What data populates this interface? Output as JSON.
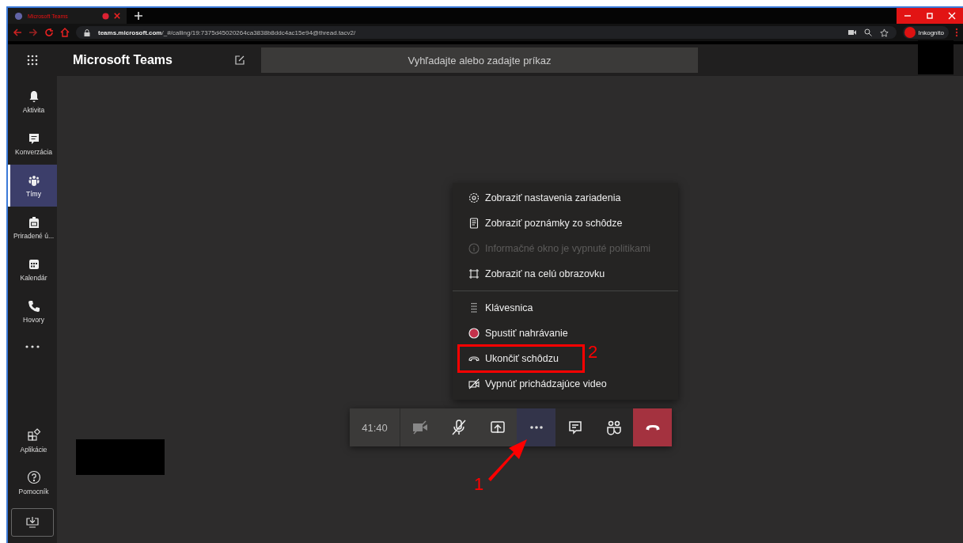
{
  "browser": {
    "tab_title": "Microsoft Teams",
    "url_host": "teams.microsoft.com",
    "url_path": "/_#/calling/19:7375d45020264ca3838b8ddc4ac15e94@thread.tacv2/",
    "profile": "Inkognito"
  },
  "app": {
    "title": "Microsoft Teams",
    "search": {
      "placeholder": "Vyhľadajte alebo zadajte príkaz"
    }
  },
  "sidebar": {
    "items": [
      {
        "label": "Aktivita",
        "selected": false
      },
      {
        "label": "Konverzácia",
        "selected": false
      },
      {
        "label": "Tímy",
        "selected": true
      },
      {
        "label": "Priradené ú...",
        "selected": false
      },
      {
        "label": "Kalendár",
        "selected": false
      },
      {
        "label": "Hovory",
        "selected": false
      }
    ],
    "bottom_items": [
      {
        "label": "Aplikácie"
      },
      {
        "label": "Pomocník"
      }
    ]
  },
  "menu": {
    "sections": [
      [
        {
          "label": "Zobraziť nastavenia zariadenia",
          "disabled": false,
          "highlighted": false
        },
        {
          "label": "Zobraziť poznámky zo schôdze",
          "disabled": false,
          "highlighted": false
        },
        {
          "label": "Informačné okno je vypnuté politikami",
          "disabled": true,
          "highlighted": false
        },
        {
          "label": "Zobraziť na celú obrazovku",
          "disabled": false,
          "highlighted": false
        }
      ],
      [
        {
          "label": "Klávesnica",
          "disabled": false,
          "highlighted": false
        },
        {
          "label": "Spustiť nahrávanie",
          "disabled": false,
          "highlighted": false
        },
        {
          "label": "Ukončiť schôdzu",
          "disabled": false,
          "highlighted": true
        },
        {
          "label": "Vypnúť prichádzajúce video",
          "disabled": false,
          "highlighted": false
        }
      ]
    ]
  },
  "call_bar": {
    "timer": "41:40",
    "buttons": [
      {
        "kind": "camera",
        "selected": false
      },
      {
        "kind": "mic",
        "selected": false
      },
      {
        "kind": "share",
        "selected": false
      },
      {
        "kind": "more",
        "selected": true
      },
      {
        "kind": "chat",
        "selected": false
      },
      {
        "kind": "people",
        "selected": false
      },
      {
        "kind": "hangup",
        "selected": false
      }
    ]
  },
  "annotations": [
    {
      "label": "1"
    },
    {
      "label": "2"
    }
  ]
}
